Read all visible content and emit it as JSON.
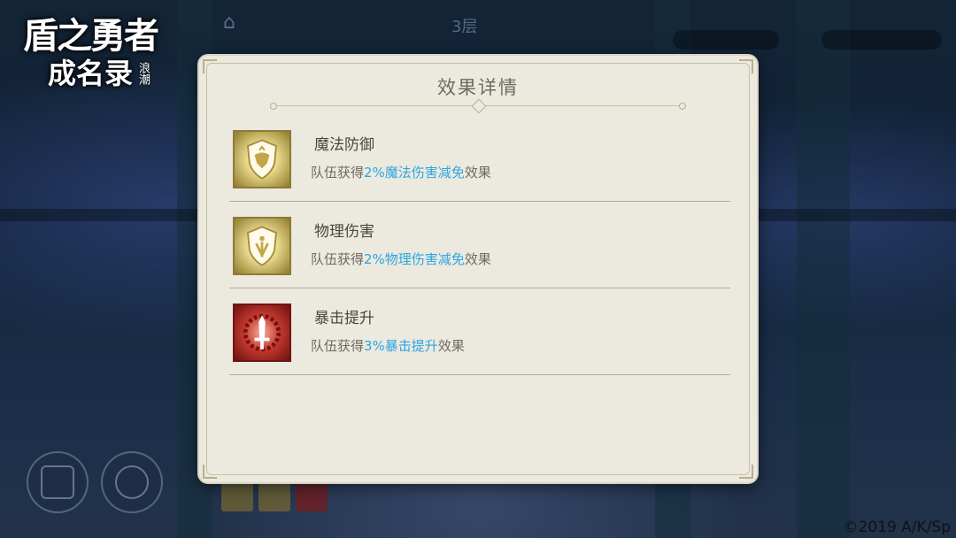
{
  "game": {
    "logo_line1": "盾之勇者",
    "logo_line2": "成名录",
    "logo_line3": "浪潮",
    "floor_label": "3层",
    "copyright": "©2019 A/K/Sp"
  },
  "panel": {
    "title": "效果详情",
    "effects": [
      {
        "name": "魔法防御",
        "desc_prefix": "队伍获得",
        "desc_highlight": "2%魔法伤害减免",
        "desc_suffix": "效果",
        "icon": "magic-defense-shield-icon",
        "icon_color": "#e8d98d"
      },
      {
        "name": "物理伤害",
        "desc_prefix": "队伍获得",
        "desc_highlight": "2%物理伤害减免",
        "desc_suffix": "效果",
        "icon": "physical-defense-shield-icon",
        "icon_color": "#e8d98d"
      },
      {
        "name": "暴击提升",
        "desc_prefix": "队伍获得",
        "desc_highlight": "3%暴击提升",
        "desc_suffix": "效果",
        "icon": "crit-sword-icon",
        "icon_color": "#c53a2e"
      }
    ]
  },
  "colors": {
    "highlight": "#2ba7e0",
    "panel_bg": "#ece9df",
    "text_main": "#4a4640"
  }
}
